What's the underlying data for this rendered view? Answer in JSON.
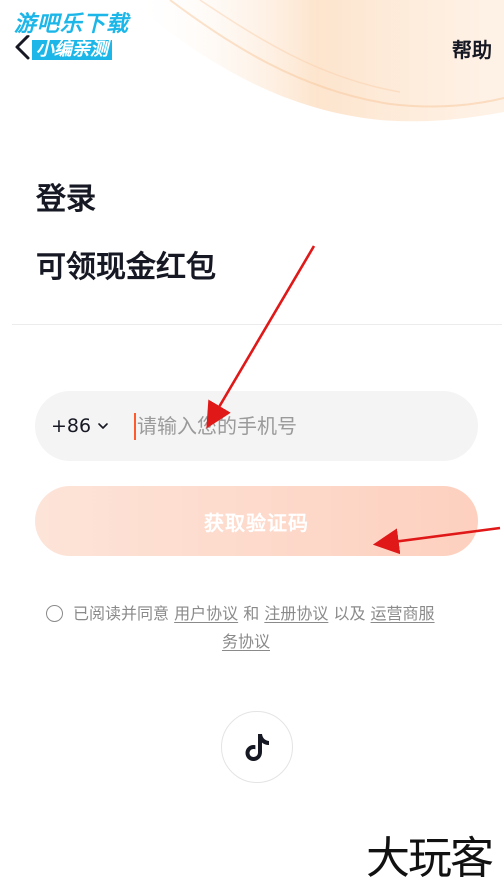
{
  "watermark": {
    "top_line1": "游吧乐下载",
    "top_line2": "小编亲测",
    "bottom": "大玩客"
  },
  "header": {
    "help_label": "帮助"
  },
  "title": "登录",
  "subtitle": "可领现金红包",
  "phone": {
    "country_code": "+86",
    "placeholder": "请输入您的手机号",
    "value": ""
  },
  "get_code_label": "获取验证码",
  "agreement": {
    "prefix": "已阅读并同意",
    "user_agreement": "用户协议",
    "and": "和",
    "register_agreement": "注册协议",
    "also": "以及",
    "operator_service_1": "运营商服",
    "operator_service_2": "务协议"
  },
  "icons": {
    "back": "chevron-left-icon",
    "tiktok": "tiktok-logo-icon",
    "dropdown": "chevron-down-icon"
  },
  "colors": {
    "accent": "#fe5a2b",
    "button_start": "#fde4d8",
    "button_end": "#fdd0bf",
    "annotation_arrow": "#e01818"
  }
}
